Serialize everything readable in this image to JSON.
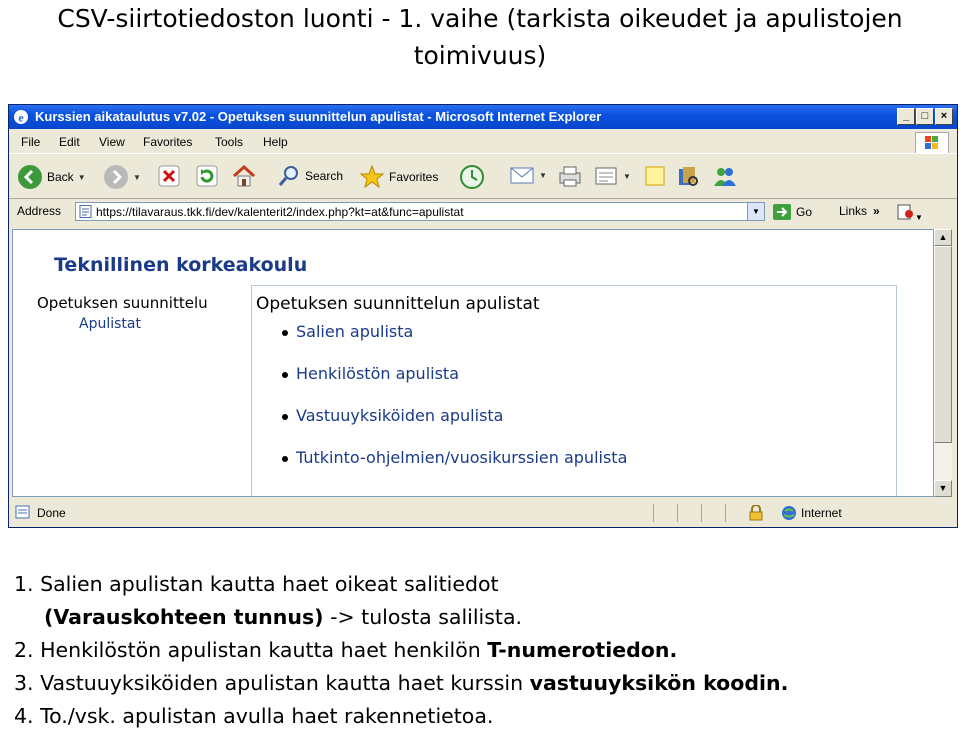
{
  "slide": {
    "title": "CSV-siirtotiedoston luonti - 1. vaihe (tarkista oikeudet ja apulistojen toimivuus)"
  },
  "window": {
    "title": "Kurssien aikataulutus v7.02 - Opetuksen suunnittelun apulistat - Microsoft Internet Explorer",
    "menu": [
      "File",
      "Edit",
      "View",
      "Favorites",
      "Tools",
      "Help"
    ],
    "toolbar": {
      "back": "Back",
      "search": "Search",
      "favorites": "Favorites"
    },
    "address": {
      "label": "Address",
      "url": "https://tilavaraus.tkk.fi/dev/kalenterit2/index.php?kt=at&func=apulistat",
      "go": "Go",
      "links": "Links"
    },
    "status": {
      "text": "Done",
      "zone": "Internet"
    }
  },
  "page": {
    "org": "Teknillinen korkeakoulu",
    "side_title": "Opetuksen suunnittelu",
    "side_sub": "Apulistat",
    "panel_title": "Opetuksen suunnittelun apulistat",
    "links": [
      "Salien apulista",
      "Henkilöstön apulista",
      "Vastuuyksiköiden apulista",
      "Tutkinto-ohjelmien/vuosikurssien apulista"
    ]
  },
  "notes": {
    "n1a": "1. Salien apulistan kautta haet oikeat salitiedot",
    "n1b_bold": "(Varauskohteen tunnus)",
    "n1b_rest": " -> tulosta salilista.",
    "n2_pre": "2. Henkilöstön apulistan kautta haet henkilön ",
    "n2_bold": "T-numerotiedon.",
    "n3_pre": "3. Vastuuyksiköiden apulistan kautta haet kurssin ",
    "n3_bold": "vastuuyksikön koodin.",
    "n4": "4. To./vsk. apulistan avulla haet rakennetietoa."
  }
}
